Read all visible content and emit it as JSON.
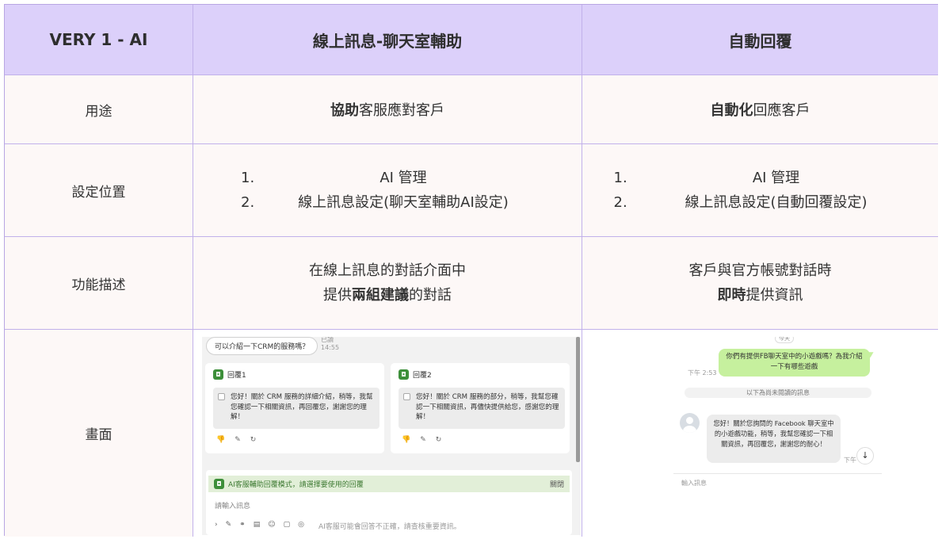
{
  "header": {
    "col1": "VERY 1 - AI",
    "col2": "線上訊息-聊天室輔助",
    "col3": "自動回覆"
  },
  "rows": {
    "purpose": {
      "label": "用途",
      "col2": {
        "bold": "協助",
        "rest": "客服應對客戶"
      },
      "col3": {
        "bold": "自動化",
        "rest": "回應客戶"
      }
    },
    "setting": {
      "label": "設定位置",
      "col2": [
        {
          "num": "1.",
          "text": "AI 管理"
        },
        {
          "num": "2.",
          "text": "線上訊息設定(聊天室輔助AI設定)"
        }
      ],
      "col3": [
        {
          "num": "1.",
          "text": "AI 管理"
        },
        {
          "num": "2.",
          "text": "線上訊息設定(自動回覆設定)"
        }
      ]
    },
    "feature": {
      "label": "功能描述",
      "col2": {
        "line1": "在線上訊息的對話介面中",
        "pre": "提供",
        "bold": "兩組建議",
        "post": "的對話"
      },
      "col3": {
        "line1": "客戶與官方帳號對話時",
        "bold": "即時",
        "post": "提供資訊"
      }
    },
    "screen": {
      "label": "畫面"
    }
  },
  "shotA": {
    "question": "可以介紹一下CRM的服務嗎？",
    "read": "已讀",
    "time": "14:55",
    "reply1": {
      "title": "回覆1",
      "text": "您好！關於 CRM 服務的詳細介紹，稍等，我幫您確認一下相關資訊，再回覆您，謝謝您的理解！"
    },
    "reply2": {
      "title": "回覆2",
      "text": "您好！關於 CRM 服務的部分，稍等，我幫您確認一下相關資訊，再儘快提供給您，感謝您的理解！"
    },
    "tools": [
      "👎",
      "✎",
      "↻"
    ],
    "assist_bar": "AI客服輔助回覆模式，請選擇要使用的回覆",
    "close": "關閉",
    "input_placeholder": "請輸入訊息",
    "bottom_tools": [
      "›",
      "✎",
      "⚭",
      "▤",
      "☺",
      "▢",
      "◎"
    ],
    "disclaimer": "AI客服可能會回答不正確，請查核重要資訊。"
  },
  "shotB": {
    "top_chip": "今天",
    "customer_msg": "你們有提供FB聊天室中的小遊戲嗎？為我介紹一下有哪些遊戲",
    "customer_time": "下午 2:53",
    "unread_divider": "以下為尚未閱讀的訊息",
    "bot_msg": "您好！關於您詢問的 Facebook 聊天室中的小遊戲功能，稍等，我幫您確認一下相關資訊，再回覆您，謝謝您的耐心！",
    "bot_time": "下午",
    "down_icon": "↓",
    "input_placeholder": "輸入訊息"
  },
  "colors": {
    "header_bg": "#dcd0fa",
    "row_bg": "#fdf8f7",
    "border": "#c1b1ea",
    "green_bubble": "#c6f09e",
    "assist_bar": "#e2efd8"
  }
}
